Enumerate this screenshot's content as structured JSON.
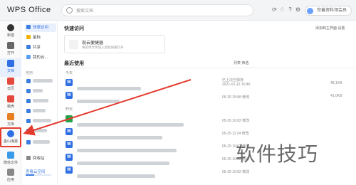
{
  "app": {
    "title": "WPS Office"
  },
  "search": {
    "placeholder": "搜索文档"
  },
  "header": {
    "vip_label": "完善资料领会员"
  },
  "rail": [
    {
      "label": "新建",
      "color": "#333333"
    },
    {
      "label": "打开",
      "color": "#555555"
    },
    {
      "label": "文档",
      "color": "#2f6fe4"
    },
    {
      "label": "日历",
      "color": "#e5483d"
    },
    {
      "label": "稿壳",
      "color": "#e5483d"
    },
    {
      "label": "文库",
      "color": "#e67e22"
    },
    {
      "label": "金山海报",
      "color": "#2f6fe4"
    },
    {
      "label": "微信文件",
      "color": "#3b9be8"
    },
    {
      "label": "应用",
      "color": "#555555"
    }
  ],
  "sidebar": {
    "items": [
      {
        "label": "快速访问"
      },
      {
        "label": "星标"
      },
      {
        "label": "共享"
      },
      {
        "label": "我的云..."
      }
    ],
    "section_label": "常用",
    "bottom": [
      {
        "label": "回收站"
      }
    ],
    "cloud_link": "查看云空间"
  },
  "main": {
    "quick_access_title": "快速访问",
    "quick_access_right": "添加到主界面 设置",
    "quick_card": {
      "title": "现云便捷器",
      "subtitle": "将常用文件加入此处快速打开"
    },
    "recent_title": "最近使用",
    "recent_tools": "列表    筛选",
    "groups": [
      {
        "label": "今天"
      },
      {
        "label": "昨天"
      }
    ],
    "rows": [
      {
        "type": "W",
        "meta1": "已上次已保存",
        "meta2": "2021-01-12 10:46",
        "size": "48,1KB"
      },
      {
        "type": "W",
        "meta1": "",
        "meta2": "05-30 15:58 修改",
        "size": "41,0KB"
      },
      {
        "type": "W",
        "meta1": "",
        "meta2": "05-29 10:02 修改",
        "size": ""
      },
      {
        "type": "W",
        "meta1": "",
        "meta2": "05-29 11:24 修改",
        "size": ""
      },
      {
        "type": "W",
        "meta1": "",
        "meta2": "05-29 10:02 修改",
        "size": ""
      },
      {
        "type": "W",
        "meta1": "",
        "meta2": "05-29 10:02 修改",
        "size": ""
      },
      {
        "type": "W",
        "meta1": "",
        "meta2": "05-29 10:02 修改",
        "size": ""
      }
    ]
  },
  "watermark": "软件技巧",
  "colors": {
    "accent": "#2f6fe4",
    "highlight": "#e33b2e"
  }
}
